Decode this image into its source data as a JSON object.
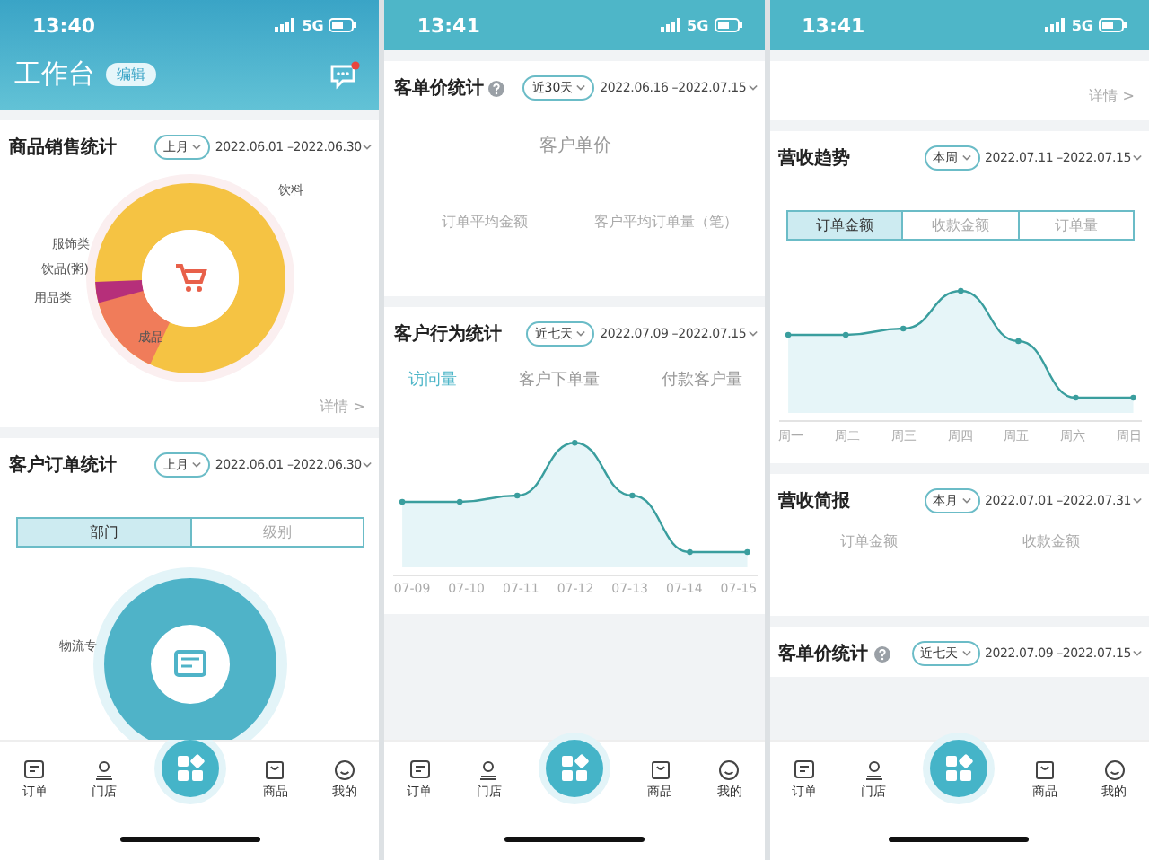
{
  "phones": [
    {
      "status_bar": {
        "time": "13:40",
        "network": "5G"
      },
      "header": {
        "title": "工作台",
        "badge": "编辑",
        "unread": true
      },
      "sections": [
        {
          "title": "商品销售统计",
          "help": false,
          "period": "上月",
          "range": "2022.06.01 –2022.06.30",
          "chart": {
            "kind": "donut",
            "labels": [
              "饮料",
              "服饰类",
              "饮品(粥)",
              "用品类",
              "成品"
            ]
          },
          "details": "详情 >"
        },
        {
          "title": "客户订单统计",
          "help": false,
          "period": "上月",
          "range": "2022.06.01 –2022.06.30",
          "segments": [
            {
              "label": "部门",
              "selected": true
            },
            {
              "label": "级别",
              "selected": false
            }
          ],
          "chart": {
            "kind": "ring",
            "labels": [
              "物流专"
            ]
          }
        }
      ],
      "nav": [
        {
          "kind": "tab",
          "label": "订单"
        },
        {
          "kind": "tab",
          "label": "门店"
        },
        {
          "kind": "fab"
        },
        {
          "kind": "tab",
          "label": "商品"
        },
        {
          "kind": "tab",
          "label": "我的"
        }
      ]
    },
    {
      "status_bar": {
        "time": "13:41",
        "network": "5G"
      },
      "sections": [
        {
          "title": "客单价统计",
          "help": true,
          "period": "近30天",
          "range": "2022.06.16 –2022.07.15",
          "subtitle": "客户单价",
          "metrics": [
            "订单平均金额",
            "客户平均订单量（笔）"
          ]
        },
        {
          "title": "客户行为统计",
          "help": false,
          "period": "近七天",
          "range": "2022.07.09 –2022.07.15",
          "tabs": [
            {
              "label": "访问量",
              "selected": true
            },
            {
              "label": "客户下单量",
              "selected": false
            },
            {
              "label": "付款客户量",
              "selected": false
            }
          ],
          "chart": {
            "kind": "line",
            "labels": [
              "07-09",
              "07-10",
              "07-11",
              "07-12",
              "07-13",
              "07-14",
              "07-15"
            ]
          }
        }
      ],
      "nav": [
        {
          "kind": "tab",
          "label": "订单"
        },
        {
          "kind": "tab",
          "label": "门店"
        },
        {
          "kind": "fab"
        },
        {
          "kind": "tab",
          "label": "商品"
        },
        {
          "kind": "tab",
          "label": "我的"
        }
      ]
    },
    {
      "status_bar": {
        "time": "13:41",
        "network": "5G"
      },
      "top_details": "详情 >",
      "sections": [
        {
          "title": "营收趋势",
          "help": false,
          "period": "本周",
          "range": "2022.07.11 –2022.07.15",
          "segments": [
            {
              "label": "订单金额",
              "selected": true
            },
            {
              "label": "收款金额",
              "selected": false
            },
            {
              "label": "订单量",
              "selected": false
            }
          ],
          "chart": {
            "kind": "line",
            "labels": [
              "周一",
              "周二",
              "周三",
              "周四",
              "周五",
              "周六",
              "周日"
            ]
          }
        },
        {
          "title": "营收简报",
          "help": false,
          "period": "本月",
          "range": "2022.07.01 –2022.07.31",
          "metrics": [
            "订单金额",
            "收款金额"
          ]
        },
        {
          "title": "客单价统计",
          "help": true,
          "period": "近七天",
          "range": "2022.07.09 –2022.07.15"
        }
      ],
      "nav": [
        {
          "kind": "tab",
          "label": "订单"
        },
        {
          "kind": "tab",
          "label": "门店"
        },
        {
          "kind": "fab"
        },
        {
          "kind": "tab",
          "label": "商品"
        },
        {
          "kind": "tab",
          "label": "我的"
        }
      ]
    }
  ]
}
